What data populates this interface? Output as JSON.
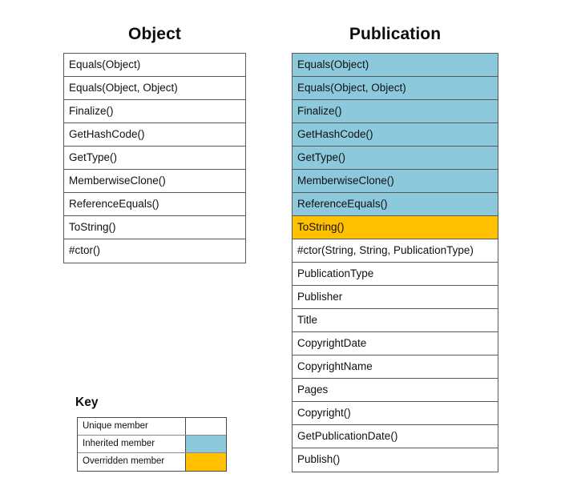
{
  "diagram": {
    "classes": [
      {
        "name": "object-class",
        "title": "Object",
        "members": [
          {
            "label": "Equals(Object)",
            "fill": "none"
          },
          {
            "label": "Equals(Object,  Object)",
            "fill": "none"
          },
          {
            "label": "Finalize()",
            "fill": "none"
          },
          {
            "label": "GetHashCode()",
            "fill": "none"
          },
          {
            "label": "GetType()",
            "fill": "none"
          },
          {
            "label": "MemberwiseClone()",
            "fill": "none"
          },
          {
            "label": "ReferenceEquals()",
            "fill": "none"
          },
          {
            "label": "ToString()",
            "fill": "none"
          },
          {
            "label": "#ctor()",
            "fill": "none"
          }
        ]
      },
      {
        "name": "publication-class",
        "title": "Publication",
        "members": [
          {
            "label": "Equals(Object)",
            "fill": "inherited"
          },
          {
            "label": "Equals(Object,  Object)",
            "fill": "inherited"
          },
          {
            "label": "Finalize()",
            "fill": "inherited"
          },
          {
            "label": "GetHashCode()",
            "fill": "inherited"
          },
          {
            "label": "GetType()",
            "fill": "inherited"
          },
          {
            "label": "MemberwiseClone()",
            "fill": "inherited"
          },
          {
            "label": "ReferenceEquals()",
            "fill": "inherited"
          },
          {
            "label": "ToString()",
            "fill": "overridden"
          },
          {
            "label": "#ctor(String,  String,  PublicationType)",
            "fill": "none"
          },
          {
            "label": "PublicationType",
            "fill": "none"
          },
          {
            "label": "Publisher",
            "fill": "none"
          },
          {
            "label": "Title",
            "fill": "none"
          },
          {
            "label": "CopyrightDate",
            "fill": "none"
          },
          {
            "label": "CopyrightName",
            "fill": "none"
          },
          {
            "label": "Pages",
            "fill": "none"
          },
          {
            "label": "Copyright()",
            "fill": "none"
          },
          {
            "label": "GetPublicationDate()",
            "fill": "none"
          },
          {
            "label": "Publish()",
            "fill": "none"
          }
        ]
      }
    ]
  },
  "key": {
    "title": "Key",
    "entries": [
      {
        "label": "Unique member",
        "fill": "none"
      },
      {
        "label": "Inherited member",
        "fill": "inherited"
      },
      {
        "label": "Overridden member",
        "fill": "overridden"
      }
    ]
  },
  "colors": {
    "none": "#FFFFFF",
    "inherited": "#8DC9DD",
    "overridden": "#FFC000",
    "border": "#595959",
    "text": "#101010"
  }
}
